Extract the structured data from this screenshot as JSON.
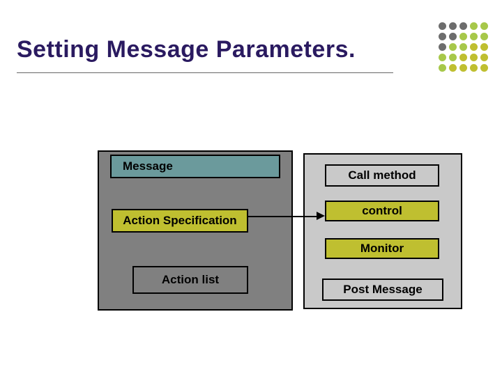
{
  "title": "Setting Message Parameters.",
  "left": {
    "message": "Message",
    "action_spec": "Action Specification",
    "action_list": "Action list"
  },
  "right": {
    "call_method": "Call method",
    "control": "control",
    "monitor": "Monitor",
    "post_message": "Post Message"
  },
  "decor": {
    "dot_colors": [
      "#6d6d6d",
      "#a7c84a",
      "#bfbf30"
    ]
  }
}
